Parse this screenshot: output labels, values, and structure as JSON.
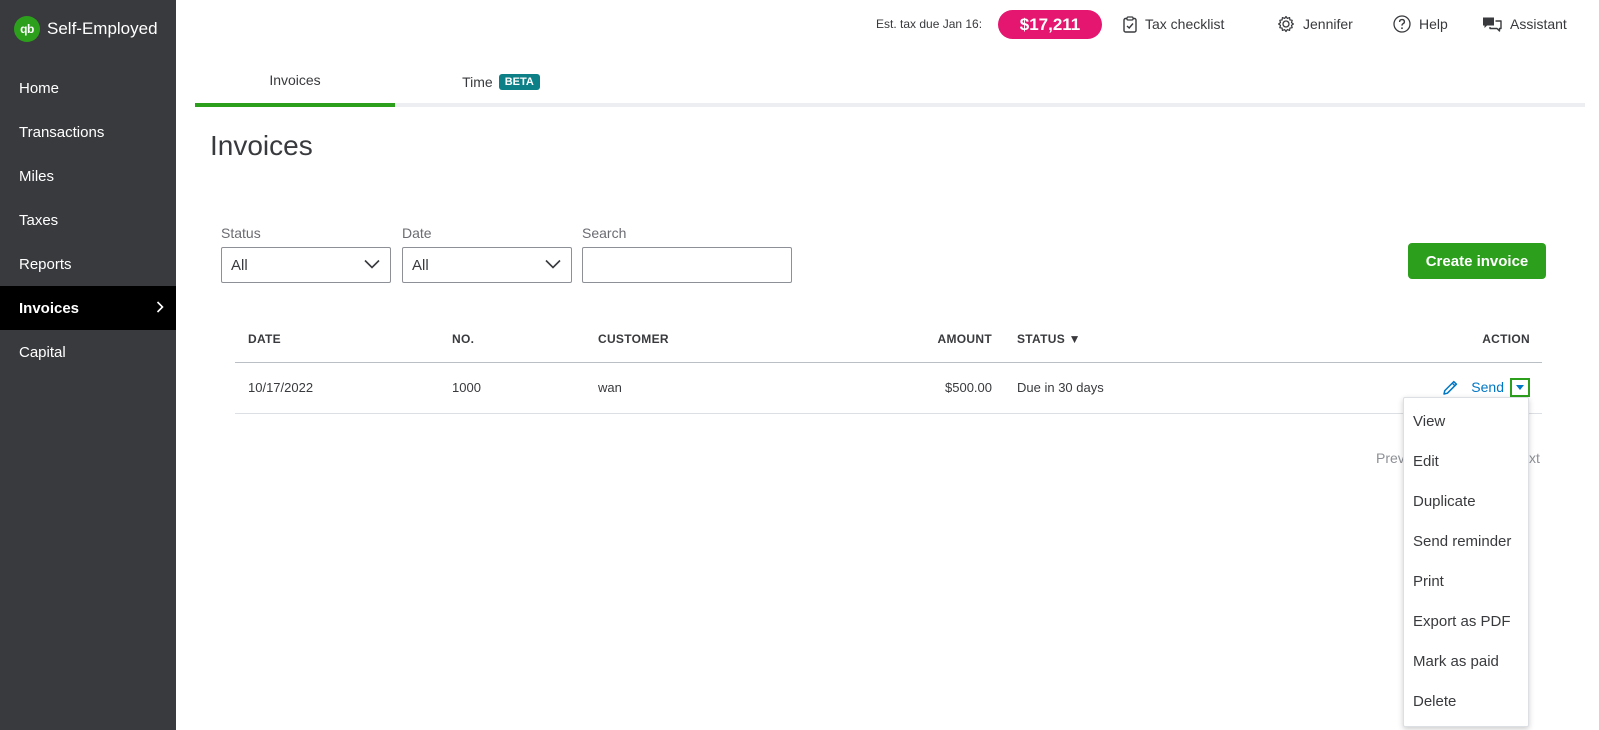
{
  "brand": {
    "logo_text": "qb",
    "name": "Self-Employed"
  },
  "sidebar": {
    "items": [
      {
        "label": "Home"
      },
      {
        "label": "Transactions"
      },
      {
        "label": "Miles"
      },
      {
        "label": "Taxes"
      },
      {
        "label": "Reports"
      },
      {
        "label": "Invoices",
        "active": true
      },
      {
        "label": "Capital"
      }
    ]
  },
  "header": {
    "est_tax_label": "Est. tax due Jan 16:",
    "est_tax_amount": "$17,211",
    "tax_checklist": "Tax checklist",
    "user": "Jennifer",
    "help": "Help",
    "assistant": "Assistant"
  },
  "tabs": [
    {
      "label": "Invoices",
      "active": true
    },
    {
      "label": "Time",
      "badge": "BETA"
    }
  ],
  "page_title": "Invoices",
  "filters": {
    "status_label": "Status",
    "status_value": "All",
    "date_label": "Date",
    "date_value": "All",
    "search_label": "Search",
    "search_value": "",
    "search_placeholder": ""
  },
  "create_button": "Create invoice",
  "table": {
    "headers": {
      "date": "DATE",
      "no": "NO.",
      "customer": "CUSTOMER",
      "amount": "AMOUNT",
      "status": "STATUS ▼",
      "action": "ACTION"
    },
    "rows": [
      {
        "date": "10/17/2022",
        "no": "1000",
        "customer": "wan",
        "amount": "$500.00",
        "status": "Due in 30 days",
        "action_label": "Send"
      }
    ]
  },
  "pagination": {
    "prev_partial": "Prev",
    "next_partial": "xt"
  },
  "action_menu": {
    "items": [
      "View",
      "Edit",
      "Duplicate",
      "Send reminder",
      "Print",
      "Export as PDF",
      "Mark as paid",
      "Delete"
    ]
  },
  "colors": {
    "sidebar_bg": "#393a3d",
    "active_nav": "#000000",
    "brand_green": "#2ca01c",
    "tax_pill": "#e5166f",
    "beta_badge": "#0d7f86",
    "link_blue": "#0077c5"
  },
  "icons": {
    "brand": "quickbooks-logo-icon",
    "tax_checklist": "clipboard-check-icon",
    "user": "gear-icon",
    "help": "question-circle-icon",
    "assistant": "chat-bubbles-icon",
    "nav_active": "chevron-right-icon",
    "select": "chevron-down-icon",
    "edit": "pencil-icon",
    "action_dropdown": "caret-down-icon"
  }
}
